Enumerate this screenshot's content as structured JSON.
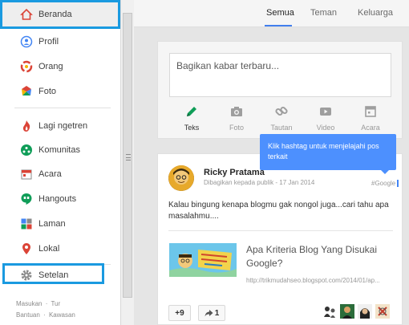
{
  "sidebar": {
    "items": [
      {
        "label": "Beranda",
        "icon": "home-icon"
      },
      {
        "label": "Profil",
        "icon": "profile-icon"
      },
      {
        "label": "Orang",
        "icon": "people-icon"
      },
      {
        "label": "Foto",
        "icon": "photos-icon"
      },
      {
        "label": "Lagi ngetren",
        "icon": "trending-icon"
      },
      {
        "label": "Komunitas",
        "icon": "communities-icon"
      },
      {
        "label": "Acara",
        "icon": "events-icon"
      },
      {
        "label": "Hangouts",
        "icon": "hangouts-icon"
      },
      {
        "label": "Laman",
        "icon": "pages-icon"
      },
      {
        "label": "Lokal",
        "icon": "local-icon"
      },
      {
        "label": "Setelan",
        "icon": "settings-icon"
      }
    ],
    "footer": {
      "line1": [
        "Masukan",
        "·",
        "Tur"
      ],
      "line2": [
        "Bantuan",
        "·",
        "Kawasan"
      ]
    }
  },
  "tabs": [
    {
      "label": "Semua"
    },
    {
      "label": "Teman"
    },
    {
      "label": "Keluarga"
    }
  ],
  "share": {
    "placeholder": "Bagikan kabar terbaru...",
    "actions": [
      {
        "label": "Teks",
        "icon": "pencil-icon"
      },
      {
        "label": "Foto",
        "icon": "camera-icon"
      },
      {
        "label": "Tautan",
        "icon": "link-icon"
      },
      {
        "label": "Video",
        "icon": "video-icon"
      },
      {
        "label": "Acara",
        "icon": "event-icon"
      }
    ]
  },
  "tooltip": {
    "text": "Klik hashtag untuk menjelajahi pos terkait"
  },
  "post": {
    "author": "Ricky Pratama",
    "meta": "Dibagikan kepada publik - 17 Jan 2014",
    "hashtag": "#Google",
    "text": "Kalau bingung kenapa blogmu gak nongol juga...cari tahu apa masalahmu....",
    "link_title": "Apa Kriteria Blog Yang Disukai Google?",
    "link_url": "http://trikmudahseo.blogspot.com/2014/01/ap...",
    "plus_label": "+9",
    "share_count": "1"
  },
  "colors": {
    "highlight": "#1a9ae0",
    "accent": "#427fed",
    "tooltip": "#4d90fe"
  }
}
